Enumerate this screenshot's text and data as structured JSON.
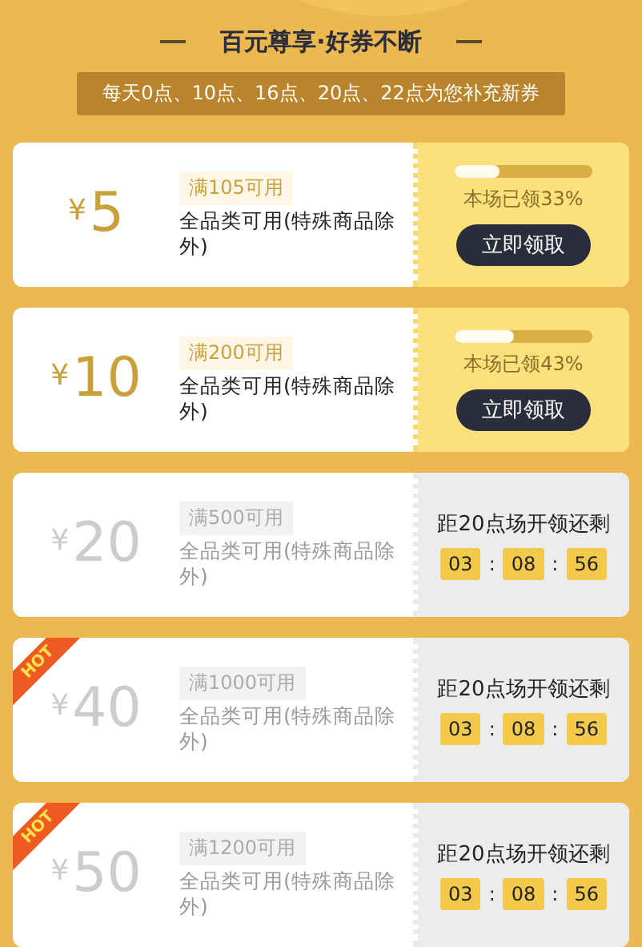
{
  "header": {
    "title": "百元尊享·好券不断",
    "banner": "每天0点、10点、16点、20点、22点为您补充新券"
  },
  "coupons": [
    {
      "kind": "claim",
      "hot": false,
      "currency": "¥",
      "amount": "5",
      "threshold": "满105可用",
      "scope": "全品类可用(特殊商品除外)",
      "level": 0.33,
      "claimed": "本场已领33%",
      "button": "立即领取"
    },
    {
      "kind": "claim",
      "hot": false,
      "currency": "¥",
      "amount": "10",
      "threshold": "满200可用",
      "scope": "全品类可用(特殊商品除外)",
      "level": 0.43,
      "claimed": "本场已领43%",
      "button": "立即领取"
    },
    {
      "kind": "countdown",
      "hot": false,
      "currency": "¥",
      "amount": "20",
      "threshold": "满500可用",
      "scope": "全品类可用(特殊商品除外)",
      "countdown_label": "距20点场开领还剩",
      "time": [
        "03",
        "08",
        "56"
      ],
      "separators": [
        ":",
        ":"
      ]
    },
    {
      "kind": "countdown",
      "hot": true,
      "hot_label": "HOT",
      "currency": "¥",
      "amount": "40",
      "threshold": "满1000可用",
      "scope": "全品类可用(特殊商品除外)",
      "countdown_label": "距20点场开领还剩",
      "time": [
        "03",
        "08",
        "56"
      ],
      "separators": [
        ":",
        ":"
      ]
    },
    {
      "kind": "countdown",
      "hot": true,
      "hot_label": "HOT",
      "currency": "¥",
      "amount": "50",
      "threshold": "满1200可用",
      "scope": "全品类可用(特殊商品除外)",
      "countdown_label": "距20点场开领还剩",
      "time": [
        "03",
        "08",
        "56"
      ],
      "separators": [
        ":",
        ":"
      ]
    }
  ]
}
